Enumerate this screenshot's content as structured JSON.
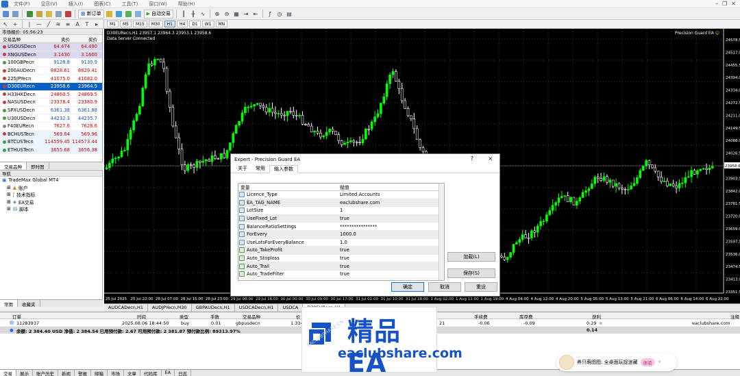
{
  "menu": {
    "items": [
      "文件(F)",
      "显示(V)",
      "插入(I)",
      "图表(C)",
      "工具(T)",
      "窗口(W)",
      "帮助(H)"
    ]
  },
  "toolbar": {
    "new_order_label": "新订单",
    "auto_trade_label": "自动交易",
    "timeframes": [
      "M1",
      "M5",
      "M15",
      "M30",
      "H1",
      "H4",
      "D1",
      "W1",
      "MN"
    ]
  },
  "market_watch": {
    "title": "市场报价: 05:56:23",
    "col_symbol": "交易品种",
    "col_bid": "卖价",
    "col_ask": "买价",
    "rows": [
      {
        "symbol": "USOUSDecn",
        "bid": "64.474",
        "ask": "64.490"
      },
      {
        "symbol": "XNGUSDecn",
        "bid": "3.1430",
        "ask": "3.1600"
      },
      {
        "symbol": "100GBPecn",
        "bid": "9128.8",
        "ask": "9130.9"
      },
      {
        "symbol": "200AUDecn",
        "bid": "8828.61",
        "ask": "8829.41"
      },
      {
        "symbol": "225JPYecn",
        "bid": "41075.0",
        "ask": "41082.0"
      },
      {
        "symbol": "D30EURecn",
        "bid": "23958.6",
        "ask": "23964.5"
      },
      {
        "symbol": "H33HKDecn",
        "bid": "24860.5",
        "ask": "24869.5"
      },
      {
        "symbol": "NASUSDecn",
        "bid": "23378.4",
        "ask": "23380.9"
      },
      {
        "symbol": "SPXUSDecn",
        "bid": "6361.38",
        "ask": "6361.88"
      },
      {
        "symbol": "U30USDecn",
        "bid": "44232.3",
        "ask": "44235.7"
      },
      {
        "symbol": "F40EURecn",
        "bid": "7627.6",
        "ask": "7628.6"
      },
      {
        "symbol": "BCHUSTecn",
        "bid": "569.64",
        "ask": "569.96"
      },
      {
        "symbol": "BTCUSTecn",
        "bid": "114559.45",
        "ask": "114573.44"
      },
      {
        "symbol": "ETHUSTecn",
        "bid": "3655.68",
        "ask": "3656.38"
      }
    ],
    "tab_symbols": "交易品种",
    "tab_ticks": "即时图"
  },
  "navigator": {
    "title": "导航",
    "root": "TradeMax Global MT4",
    "items": [
      "账户",
      "技术指标",
      "EA交易",
      "脚本"
    ],
    "tab_common": "常用",
    "tab_favorites": "收藏夹"
  },
  "chart": {
    "header": "D30EURecn,H1  23957.1 23964.3 23953.1 23958.6",
    "status": "Data Server Connected",
    "ea_label": "Precision Guard EA",
    "price_labels": [
      "24578.5",
      "24517.0",
      "24455.5",
      "24394.0",
      "24334.0",
      "24272.5",
      "24211.0",
      "24149.5",
      "24088.0",
      "24026.5",
      "23958.6",
      "23903.5",
      "23842.0",
      "23781.5",
      "23720.0",
      "23659.0",
      "23597.5",
      "23536.0",
      "23474.5",
      "23413.0",
      "23351.5"
    ],
    "current_price": "23958.6",
    "time_labels": [
      "25 Jul 2025",
      "25 Jul 22:00",
      "28 Jul 07:00",
      "28 Jul 15:00",
      "28 Jul 23:00",
      "29 Jul 08:00",
      "29 Jul 16:00",
      "30 Jul 00:00",
      "30 Jul 09:00",
      "30 Jul 17:00",
      "31 Jul 01:00",
      "31 Jul 10:00",
      "31 Jul 18:00",
      "1 Aug 02:00",
      "1 Aug 11:00",
      "1 Aug 19:00",
      "4 Aug 04:00",
      "4 Aug 12:00",
      "4 Aug 20:00",
      "5 Aug 05:00",
      "5 Aug 13:00",
      "5 Aug 21:00",
      "6 Aug 06:00",
      "6 Aug 14:00",
      "6 Aug 22:00"
    ]
  },
  "chart_tabs": [
    "AUDCADecn,H1",
    "AUDJPYecn,M30",
    "GBPAUDecn,H1",
    "USDCADecn,H1",
    "USDCA",
    "D30EURecn,H1"
  ],
  "dialog": {
    "title": "Expert - Precision Guard EA",
    "help": "?",
    "close": "×",
    "tabs": [
      "关于",
      "常用",
      "输入参数"
    ],
    "col_variable": "变量",
    "col_value": "赋值",
    "params": [
      {
        "name": "Licence_Type",
        "value": "Limited Accounts"
      },
      {
        "name": "EA_TAG_NAME",
        "value": "eaclubshare.com"
      },
      {
        "name": "LotSize",
        "value": "1"
      },
      {
        "name": "UseFixed_Lot",
        "value": "true"
      },
      {
        "name": "BalanceRatioSettings",
        "value": "****************"
      },
      {
        "name": "ForEvery",
        "value": "1000.0"
      },
      {
        "name": "UseLotsForEveryBalance",
        "value": "1.0"
      },
      {
        "name": "Auto_TakeProfit",
        "value": "true"
      },
      {
        "name": "Auto_Stoploss",
        "value": "true"
      },
      {
        "name": "Auto_Trail",
        "value": "true"
      },
      {
        "name": "Auto_TradeFilter",
        "value": "true"
      }
    ],
    "load_label": "加载(L)",
    "save_label": "保存(S)",
    "ok_label": "确定",
    "cancel_label": "取消",
    "reset_label": "重设"
  },
  "terminal": {
    "cols": {
      "order": "订单",
      "time": "时间",
      "type": "类型",
      "lots": "手数",
      "symbol": "交易品种",
      "price": "价",
      "commission": "手续费",
      "swap": "库存费",
      "profit": "获利",
      "comment": "注释"
    },
    "trade": {
      "order": "11283937",
      "time": "2025.08.06 18:44:50",
      "type": "buy",
      "lots": "0.01",
      "symbol": "gbpusdecn",
      "price": "1.334",
      "commission": "-0.06",
      "swap": "-0.09",
      "profit": "0.29",
      "comment": "eaclubshare.com",
      "extra": "21"
    },
    "summary": "余额: 2 384.40 USD  净值: 2 384.54  已用预付款: 2.67  可用预付款: 2 381.87  预付款比例: 89313.97%",
    "summary_profit": "0.14"
  },
  "bottom_tabs": [
    "交易",
    "展示",
    "账户历史",
    "新闻",
    "警报",
    "邮箱",
    "市场",
    "文章",
    "代码库",
    "EA",
    "日志"
  ],
  "watermark": {
    "title": "精品EA",
    "url": "eaclubshare.com",
    "cn": "EACLUBSHARE.CN"
  },
  "chat": {
    "text": "养只萌图图: 全桌面玩捉迷藏",
    "badge": "体验"
  },
  "colors": {
    "chart_bg": "#000000",
    "bull": "#00ff00",
    "bear": "#ffffff",
    "selected_row": "#0a5fc4",
    "brand_blue": "#1552c8"
  }
}
